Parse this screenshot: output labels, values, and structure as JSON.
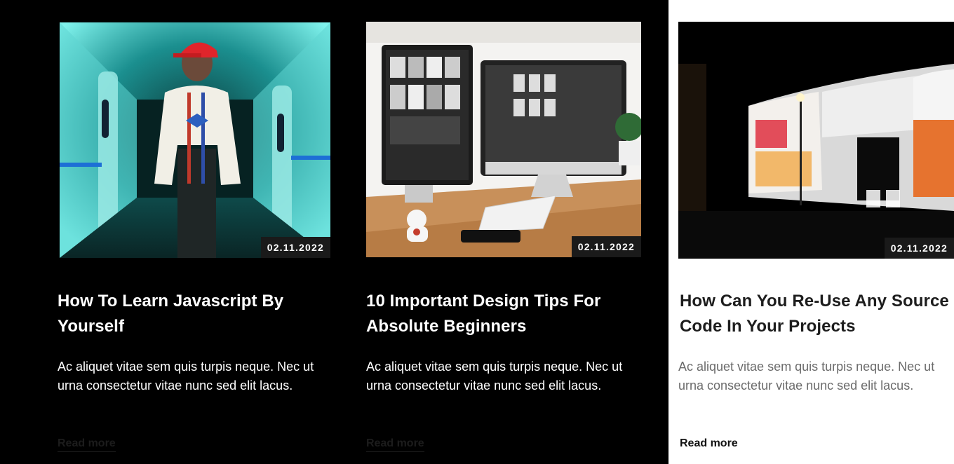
{
  "posts": [
    {
      "date": "02.11.2022",
      "title": "How To Learn Javascript By Yourself",
      "excerpt": "Ac aliquet vitae sem quis turpis neque. Nec ut urna consectetur vitae nunc sed elit lacus.",
      "read_more": "Read more",
      "theme": "dark",
      "image_subject": "person in white sweater and red cap in teal-lit hallway"
    },
    {
      "date": "02.11.2022",
      "title": "10 Important Design Tips For Absolute Beginners",
      "excerpt": "Ac aliquet vitae sem quis turpis neque. Nec ut urna consectetur vitae nunc sed elit lacus.",
      "read_more": "Read more",
      "theme": "dark",
      "image_subject": "two monitors on a wooden desk with keyboard and phone"
    },
    {
      "date": "02.11.2022",
      "title": "How Can You Re-Use Any Source Code In  Your Projects",
      "excerpt": "Ac aliquet vitae sem quis turpis neque. Nec ut urna consectetur vitae nunc sed elit lacus.",
      "read_more": "Read more",
      "theme": "light",
      "image_subject": "illuminated billboards at night"
    }
  ],
  "colors": {
    "page_background": "#000000",
    "light_panel": "#ffffff",
    "badge_background": "#1a1a1a",
    "badge_text": "#ffffff"
  }
}
